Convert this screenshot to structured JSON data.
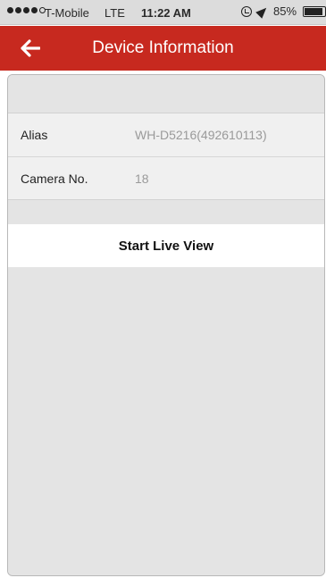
{
  "status_bar": {
    "carrier": "T-Mobile",
    "network": "LTE",
    "time": "11:22 AM",
    "battery_percent": "85%"
  },
  "nav": {
    "title": "Device Information",
    "back_icon": "arrow-left-icon"
  },
  "device_info": {
    "rows": [
      {
        "label": "Alias",
        "value": "WH-D5216(492610113)"
      },
      {
        "label": "Camera No.",
        "value": "18"
      }
    ]
  },
  "actions": {
    "start_live_view": "Start Live View"
  },
  "colors": {
    "nav_bar": "#c7291f",
    "background": "#e4e4e4"
  }
}
